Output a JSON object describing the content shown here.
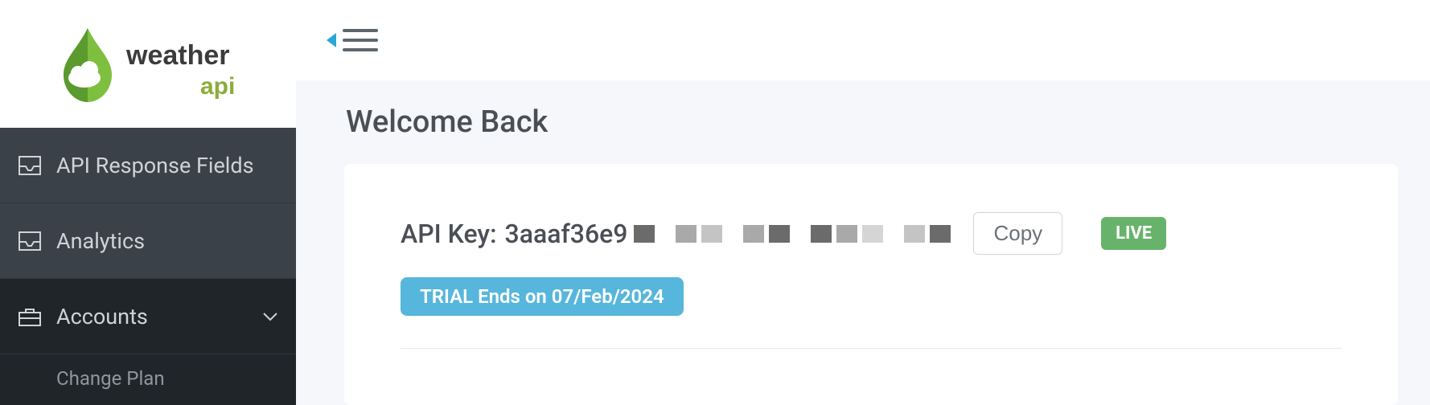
{
  "brand": {
    "name1": "weather",
    "name2": "api"
  },
  "sidebar": {
    "items": [
      {
        "label": "API Response Fields"
      },
      {
        "label": "Analytics"
      },
      {
        "label": "Accounts"
      }
    ],
    "sub": {
      "change_plan": "Change Plan"
    }
  },
  "page": {
    "title": "Welcome Back"
  },
  "api_key": {
    "label": "API Key:",
    "visible_prefix": "3aaaf36e9",
    "copy_label": "Copy",
    "status_badge": "LIVE",
    "trial_text": "TRIAL Ends on 07/Feb/2024"
  }
}
